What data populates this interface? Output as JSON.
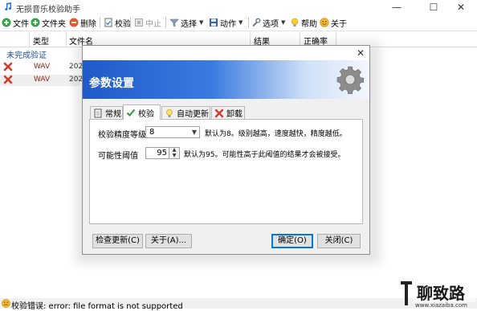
{
  "window": {
    "title": "无损音乐校验助手",
    "minimize_icon": "minimize-icon",
    "maximize_icon": "maximize-icon",
    "close_icon": "close-icon"
  },
  "toolbar": {
    "file": "文件",
    "folder": "文件夹",
    "delete": "删除",
    "verify": "校验",
    "stop": "中止",
    "select": "选择",
    "action": "动作",
    "options": "选项",
    "help": "帮助",
    "about": "关于"
  },
  "list": {
    "columns": [
      "类型",
      "文件名",
      "结果",
      "正确率"
    ],
    "group_label": "未完成验证",
    "rows": [
      {
        "type": "WAV",
        "name": "202",
        "status_icon": "error-x-icon"
      },
      {
        "type": "WAV",
        "name": "202",
        "status_icon": "error-x-icon"
      }
    ]
  },
  "dialog": {
    "title": "参数设置",
    "banner_icon": "gear-icon",
    "close_icon": "close-icon",
    "tabs": [
      {
        "label": "常规",
        "icon": "page-icon",
        "active": false
      },
      {
        "label": "校验",
        "icon": "check-icon",
        "active": true
      },
      {
        "label": "自动更新",
        "icon": "bulb-icon",
        "active": false
      },
      {
        "label": "卸载",
        "icon": "x-icon",
        "active": false
      }
    ],
    "precision": {
      "label": "校验精度等级",
      "value": "8",
      "hint": "默认为8。级别越高，速度越快，精度越低。"
    },
    "threshold": {
      "label": "可能性阈值",
      "value": "95",
      "hint": "默认为95。可能性高于此阈值的结果才会被接受。"
    },
    "buttons": {
      "check_update": "检查更新(C)",
      "about": "关于(A)...",
      "ok": "确定(O)",
      "close": "关闭(C)"
    }
  },
  "status": {
    "text": "校验错误: error: file format is not supported",
    "icon": "warning-face-icon"
  },
  "watermark": {
    "text": "聊致路",
    "url": "www.xiazaiba.com"
  },
  "colors": {
    "accent": "#1f5ac8",
    "error_red": "#d23b2b",
    "group_blue": "#1f4f9f"
  }
}
